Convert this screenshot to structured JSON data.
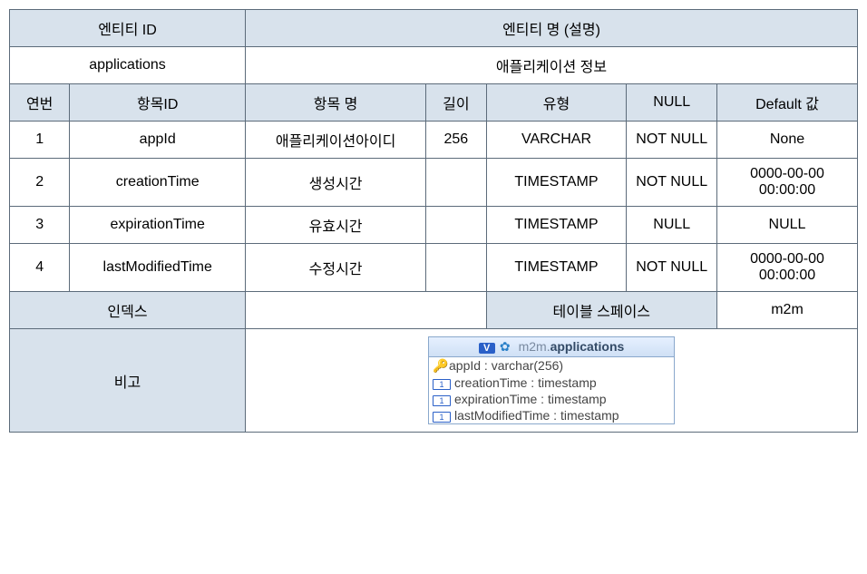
{
  "header": {
    "entity_id_label": "엔티티 ID",
    "entity_name_label": "엔티티 명 (설명)",
    "entity_id_value": "applications",
    "entity_name_value": "애플리케이션 정보"
  },
  "columns": {
    "seq": "연번",
    "item_id": "항목ID",
    "item_name": "항목 명",
    "length": "길이",
    "type": "유형",
    "null": "NULL",
    "default": "Default 값"
  },
  "rows": [
    {
      "seq": "1",
      "item_id": "appId",
      "item_name": "애플리케이션아이디",
      "length": "256",
      "type": "VARCHAR",
      "null": "NOT NULL",
      "default": "None"
    },
    {
      "seq": "2",
      "item_id": "creationTime",
      "item_name": "생성시간",
      "length": "",
      "type": "TIMESTAMP",
      "null": "NOT NULL",
      "default": "0000-00-00 00:00:00"
    },
    {
      "seq": "3",
      "item_id": "expirationTime",
      "item_name": "유효시간",
      "length": "",
      "type": "TIMESTAMP",
      "null": "NULL",
      "default": "NULL"
    },
    {
      "seq": "4",
      "item_id": "lastModifiedTime",
      "item_name": "수정시간",
      "length": "",
      "type": "TIMESTAMP",
      "null": "NOT NULL",
      "default": "0000-00-00 00:00:00"
    }
  ],
  "footer": {
    "index_label": "인덱스",
    "index_value": "",
    "tablespace_label": "테이블 스페이스",
    "tablespace_value": "m2m",
    "remarks_label": "비고"
  },
  "schema": {
    "prefix": "m2m.",
    "name": "applications",
    "cols": [
      {
        "key": true,
        "text": "appId : varchar(256)"
      },
      {
        "key": false,
        "text": "creationTime : timestamp"
      },
      {
        "key": false,
        "text": "expirationTime : timestamp"
      },
      {
        "key": false,
        "text": "lastModifiedTime : timestamp"
      }
    ]
  }
}
